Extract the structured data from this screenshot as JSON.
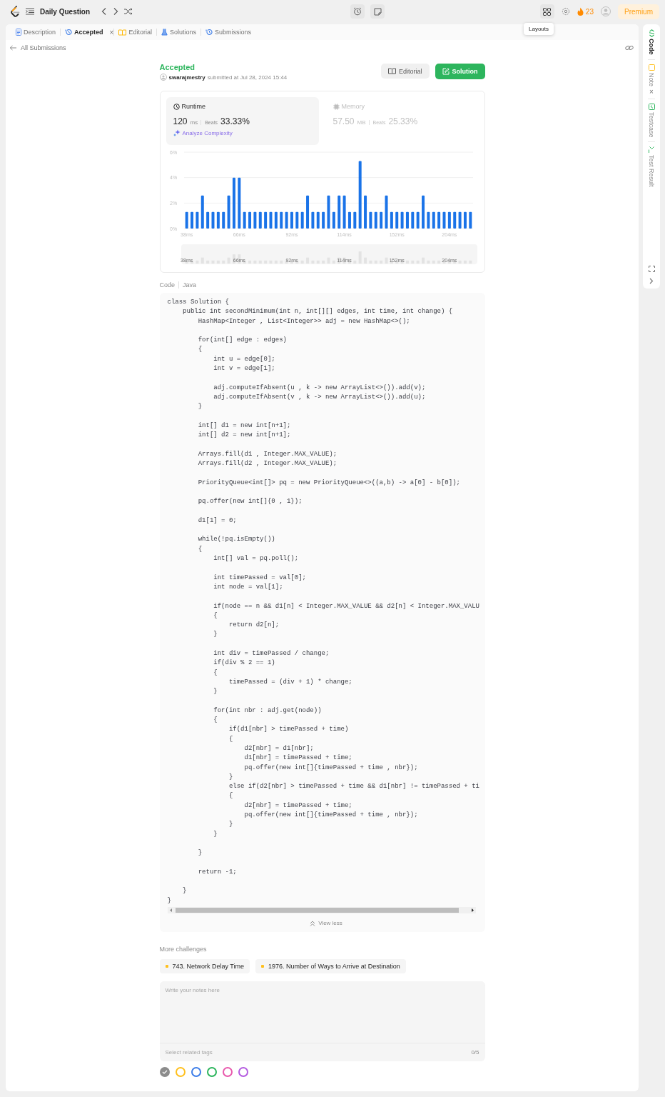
{
  "top_bar": {
    "title": "Daily Question",
    "streak": "23",
    "premium": "Premium",
    "tooltip": "Layouts"
  },
  "tabs": [
    {
      "label": "Description",
      "selected": false
    },
    {
      "label": "Accepted",
      "selected": true,
      "close": "×"
    },
    {
      "label": "Editorial",
      "selected": false
    },
    {
      "label": "Solutions",
      "selected": false
    },
    {
      "label": "Submissions",
      "selected": false
    }
  ],
  "back_link": "All Submissions",
  "result": {
    "status": "Accepted",
    "user": "swarajmestry",
    "submitted": "submitted at Jul 28, 2024 15:44",
    "buttons": [
      {
        "label": "Editorial",
        "kind": "secondary"
      },
      {
        "label": "Solution",
        "kind": "primary"
      }
    ]
  },
  "stats": [
    {
      "title": "Runtime",
      "value": "120",
      "unit": "ms",
      "beats_label": "Beats",
      "beats": "33.33%",
      "selected": true,
      "link": "Analyze Complexity"
    },
    {
      "title": "Memory",
      "value": "57.50",
      "unit": "MB",
      "beats_label": "Beats",
      "beats": "25.33%",
      "selected": false
    }
  ],
  "chart_data": {
    "type": "bar",
    "categories": [
      "38ms",
      null,
      null,
      null,
      null,
      null,
      null,
      null,
      null,
      null,
      "66ms",
      null,
      null,
      null,
      null,
      null,
      null,
      null,
      null,
      null,
      "92ms",
      null,
      null,
      null,
      null,
      null,
      null,
      null,
      null,
      null,
      "114ms",
      null,
      null,
      null,
      null,
      null,
      null,
      null,
      null,
      null,
      "152ms",
      null,
      null,
      null,
      null,
      null,
      null,
      null,
      null,
      null,
      "204ms",
      null,
      null,
      null,
      null
    ],
    "values": [
      1.3,
      1.3,
      1.3,
      2.6,
      1.3,
      1.3,
      1.3,
      1.3,
      2.6,
      4.0,
      4.0,
      1.3,
      1.3,
      1.3,
      1.3,
      1.3,
      1.3,
      1.3,
      1.3,
      1.3,
      1.3,
      1.3,
      1.3,
      2.6,
      1.3,
      1.3,
      1.3,
      2.6,
      1.3,
      2.6,
      2.6,
      1.3,
      1.3,
      5.3,
      2.6,
      1.3,
      1.3,
      1.3,
      2.6,
      1.3,
      1.3,
      1.3,
      1.3,
      1.3,
      1.3,
      2.6,
      1.3,
      1.3,
      1.3,
      1.3,
      1.3,
      1.3,
      1.3,
      1.3,
      1.3
    ],
    "color": "#1a73e8",
    "ylim": [
      0,
      6
    ],
    "yticks": [
      {
        "value": 0,
        "label": "0%"
      },
      {
        "value": 2,
        "label": "2%"
      },
      {
        "value": 4,
        "label": "4%"
      },
      {
        "value": 6,
        "label": "6%"
      }
    ]
  },
  "navigator_labels": [
    "38ms",
    "66ms",
    "92ms",
    "114ms",
    "152ms",
    "204ms"
  ],
  "code": {
    "label": "Code",
    "language": "Java",
    "text": "class Solution {\n    public int secondMinimum(int n, int[][] edges, int time, int change) {\n        HashMap<Integer , List<Integer>> adj = new HashMap<>();\n\n        for(int[] edge : edges)\n        {\n            int u = edge[0];\n            int v = edge[1];\n\n            adj.computeIfAbsent(u , k -> new ArrayList<>()).add(v);\n            adj.computeIfAbsent(v , k -> new ArrayList<>()).add(u);\n        }\n\n        int[] d1 = new int[n+1];\n        int[] d2 = new int[n+1];\n\n        Arrays.fill(d1 , Integer.MAX_VALUE);\n        Arrays.fill(d2 , Integer.MAX_VALUE);\n\n        PriorityQueue<int[]> pq = new PriorityQueue<>((a,b) -> a[0] - b[0]);\n\n        pq.offer(new int[]{0 , 1});\n\n        d1[1] = 0;\n\n        while(!pq.isEmpty())\n        {\n            int[] val = pq.poll();\n\n            int timePassed = val[0];\n            int node = val[1];\n\n            if(node == n && d1[n] < Integer.MAX_VALUE && d2[n] < Integer.MAX_VALU\n            {\n                return d2[n];\n            }\n\n            int div = timePassed / change;\n            if(div % 2 == 1)\n            {\n                timePassed = (div + 1) * change;\n            }\n\n            for(int nbr : adj.get(node))\n            {\n                if(d1[nbr] > timePassed + time)\n                {\n                    d2[nbr] = d1[nbr];\n                    d1[nbr] = timePassed + time;\n                    pq.offer(new int[]{timePassed + time , nbr});\n                }\n                else if(d2[nbr] > timePassed + time && d1[nbr] != timePassed + ti\n                {\n                    d2[nbr] = timePassed + time;\n                    pq.offer(new int[]{timePassed + time , nbr});\n                }\n            }\n\n        }\n\n        return -1;\n\n    }\n}",
    "toggle": "View less"
  },
  "more_challenges": {
    "title": "More challenges",
    "items": [
      {
        "label": "743. Network Delay Time",
        "color": "#ffc01e"
      },
      {
        "label": "1976. Number of Ways to Arrive at Destination",
        "color": "#ffc01e"
      }
    ]
  },
  "notes": {
    "placeholder": "Write your notes here",
    "tags_placeholder": "Select related tags",
    "count": "0/5"
  },
  "note_colors": [
    {
      "color": "#8c8c8c",
      "selected": true
    },
    {
      "color": "#ffc01e",
      "selected": false
    },
    {
      "color": "#3e7ee8",
      "selected": false
    },
    {
      "color": "#2db55d",
      "selected": false
    },
    {
      "color": "#e85aad",
      "selected": false
    },
    {
      "color": "#b45ce0",
      "selected": false
    }
  ],
  "side_panel": [
    {
      "label": "Code",
      "selected": true
    },
    {
      "label": "Note",
      "selected": false,
      "close": "×"
    },
    {
      "label": "Testcase",
      "selected": false
    },
    {
      "label": "Test Result",
      "selected": false
    }
  ]
}
